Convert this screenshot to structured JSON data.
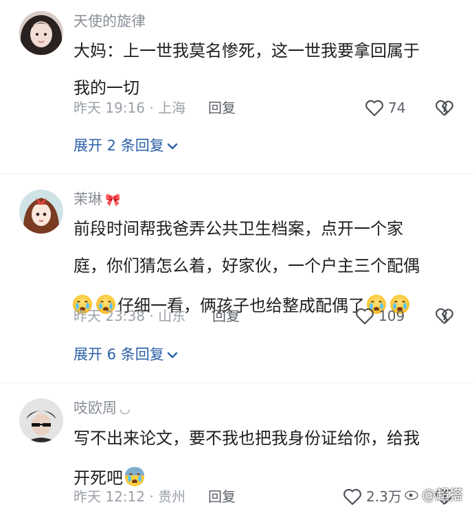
{
  "comments": [
    {
      "username": "天使的旋律",
      "lines": [
        "大妈：上一世我莫名惨死，这一世我要拿回属于",
        "我的一切"
      ],
      "time_loc": "昨天 19:16 · 上海",
      "reply": "回复",
      "likes": "74",
      "expand": "展开 2 条回复"
    },
    {
      "username": "茉琳",
      "username_deco": "🎀",
      "lines": [
        "前段时间帮我爸弄公共卫生档案，点开一个家",
        "庭，你们猜怎么着，好家伙，一个户主三个配偶",
        "仔细一看，俩孩子也给整成配偶了"
      ],
      "time_loc": "昨天 23:38 · 山东",
      "reply": "回复",
      "likes": "109",
      "expand": "展开 6 条回复"
    },
    {
      "username": "吱欧周",
      "username_deco": "◡",
      "lines": [
        "写不出来论文，要不我也把我身份证给你，给我",
        "开死吧"
      ],
      "time_loc": "昨天 12:12 · 贵州",
      "reply": "回复",
      "likes": "2.3万"
    }
  ],
  "watermark": "@超搭",
  "colors": {
    "link": "#2a5fa8",
    "meta": "#9aa0a8",
    "text": "#1e1e1e"
  }
}
